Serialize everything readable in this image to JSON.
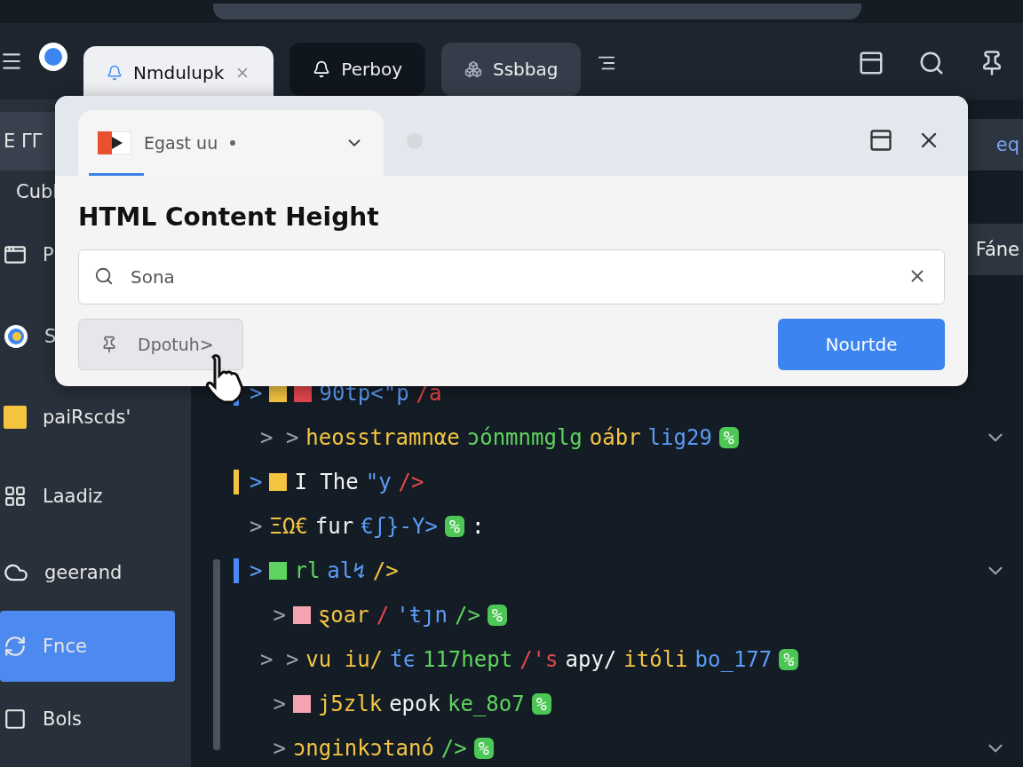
{
  "tabs": [
    {
      "label": "Nmdulupk",
      "selected": true
    },
    {
      "label": "Perboy",
      "selected": false
    },
    {
      "label": "Ssbbag",
      "selected": false
    }
  ],
  "sidebar": {
    "items": [
      {
        "label": "Ε ΓΓ",
        "kind": "box",
        "selected": false
      },
      {
        "label": "Cubl",
        "kind": "plain",
        "selected": false
      },
      {
        "label": "P",
        "kind": "window",
        "selected": false
      },
      {
        "label": "S",
        "kind": "ball",
        "selected": false
      },
      {
        "label": "paiRscds'",
        "kind": "square",
        "selected": false
      },
      {
        "label": "Laadiz",
        "kind": "grid",
        "selected": false
      },
      {
        "label": "geerand",
        "kind": "cloud",
        "selected": false
      },
      {
        "label": "Fnce",
        "kind": "g",
        "selected": true
      },
      {
        "label": "Bols",
        "kind": "frame",
        "selected": false
      }
    ]
  },
  "background_rows": [
    "eq",
    "Fáne"
  ],
  "dialog": {
    "tab": "Egast uu",
    "title": "HTML Content Height",
    "search": {
      "value": "Sona"
    },
    "secondary_button": "Dpotuh>",
    "primary_button": "Nourtde"
  },
  "code": {
    "lines": [
      {
        "marker": {
          "color": "#4a8af4"
        },
        "chevrons": ">",
        "squares": [
          {
            "color": "#f5c542"
          },
          {
            "color": "#e5484d"
          }
        ],
        "segments": [
          {
            "text": "90tp<\"p",
            "color": "#5b9cf5"
          },
          {
            "text": "/a",
            "color": "#e5484d"
          }
        ],
        "expand": false
      },
      {
        "chevrons": "> >",
        "segments": [
          {
            "text": "heosstramnαe",
            "color": "#f5c542"
          },
          {
            "text": "ɔónmnmglg",
            "color": "#5fd35f"
          },
          {
            "text": "oábr",
            "color": "#f5c542"
          },
          {
            "text": "lig29",
            "color": "#5b9cf5"
          }
        ],
        "badge": "%",
        "expand": true
      },
      {
        "marker": {
          "color": "#f5c542"
        },
        "chevrons": ">",
        "squares": [
          {
            "color": "#f5c542"
          }
        ],
        "segments": [
          {
            "text": "I The",
            "color": "#f2f2f2"
          },
          {
            "text": "\"y",
            "color": "#5b9cf5"
          },
          {
            "text": "/>",
            "color": "#e5484d"
          }
        ],
        "expand": false
      },
      {
        "chevrons": ">",
        "segments": [
          {
            "text": "ΞΩ€",
            "color": "#f5c542"
          },
          {
            "text": "fur",
            "color": "#f2f2f2"
          },
          {
            "text": "€ʃ}-Y>",
            "color": "#5b9cf5"
          }
        ],
        "badge": "%",
        "tail": ":",
        "expand": false
      },
      {
        "marker": {
          "color": "#4a8af4"
        },
        "chevrons": ">",
        "squares": [
          {
            "color": "#5fd35f"
          }
        ],
        "segments": [
          {
            "text": "rl",
            "color": "#5fd35f"
          },
          {
            "text": "al↯",
            "color": "#5b9cf5"
          },
          {
            "text": "/>",
            "color": "#f5c542"
          }
        ],
        "expand": true
      },
      {
        "chevrons": " >",
        "squares": [
          {
            "color": "#f4a3b0"
          }
        ],
        "segments": [
          {
            "text": "ȿoar",
            "color": "#f5c542"
          },
          {
            "text": "/",
            "color": "#e5484d"
          },
          {
            "text": "'ŧȷn",
            "color": "#5b9cf5"
          },
          {
            "text": "/>",
            "color": "#5fd35f"
          }
        ],
        "badge": "%",
        "expand": false
      },
      {
        "chevrons": "> >",
        "segments": [
          {
            "text": "vu iu/",
            "color": "#f5c542"
          },
          {
            "text": "ťϵ",
            "color": "#5b9cf5"
          },
          {
            "text": "117hept",
            "color": "#5fd35f"
          },
          {
            "text": "/'s",
            "color": "#e5484d"
          },
          {
            "text": "apy/",
            "color": "#f2f2f2"
          },
          {
            "text": "itóli",
            "color": "#f5c542"
          },
          {
            "text": "bo_177",
            "color": "#5b9cf5"
          }
        ],
        "badge": "%",
        "expand": false
      },
      {
        "chevrons": " >",
        "squares": [
          {
            "color": "#f4a3b0"
          }
        ],
        "segments": [
          {
            "text": "j5zlk",
            "color": "#f5c542"
          },
          {
            "text": "epok",
            "color": "#f2f2f2"
          },
          {
            "text": "ke_8o7",
            "color": "#5fd35f"
          }
        ],
        "badge": "%",
        "expand": false
      },
      {
        "chevrons": " >",
        "segments": [
          {
            "text": "ɔnginkɔtanó",
            "color": "#f5c542"
          },
          {
            "text": "/>",
            "color": "#5fd35f"
          }
        ],
        "badge": "%",
        "expand": true
      }
    ]
  }
}
